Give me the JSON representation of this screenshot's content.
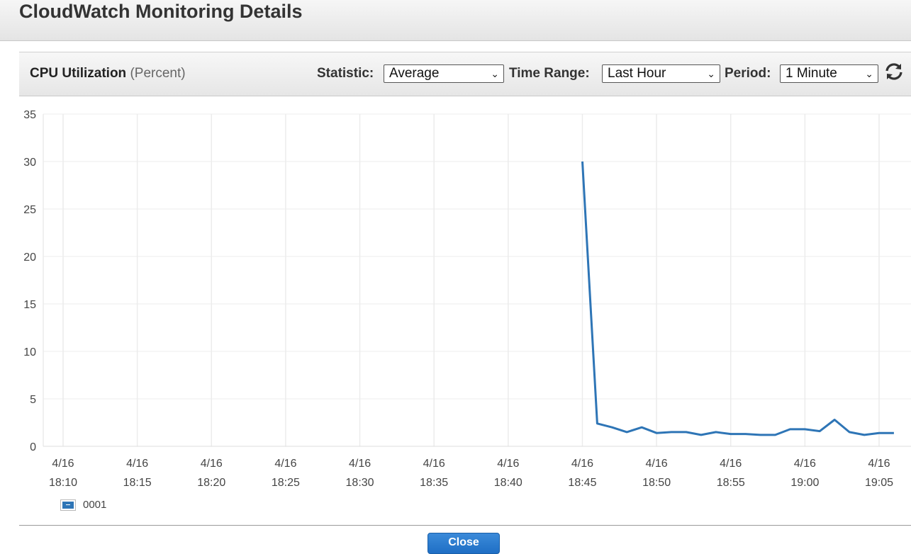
{
  "header": {
    "title": "CloudWatch Monitoring Details"
  },
  "toolbar": {
    "metric_name": "CPU Utilization",
    "metric_unit": "(Percent)",
    "statistic_label": "Statistic:",
    "statistic_value": "Average",
    "time_range_label": "Time Range:",
    "time_range_value": "Last Hour",
    "period_label": "Period:",
    "period_value": "1 Minute",
    "refresh_icon": "refresh-icon"
  },
  "colors": {
    "series": "#2e75b6",
    "grid": "#ececec",
    "axis_text": "#444444"
  },
  "chart_data": {
    "type": "line",
    "title": "",
    "xlabel": "",
    "ylabel": "",
    "ylim": [
      0,
      35
    ],
    "y_ticks": [
      0,
      5,
      10,
      15,
      20,
      25,
      30,
      35
    ],
    "x_range": [
      "18:08",
      "19:06"
    ],
    "x_ticks": [
      {
        "date": "4/16",
        "time": "18:10"
      },
      {
        "date": "4/16",
        "time": "18:15"
      },
      {
        "date": "4/16",
        "time": "18:20"
      },
      {
        "date": "4/16",
        "time": "18:25"
      },
      {
        "date": "4/16",
        "time": "18:30"
      },
      {
        "date": "4/16",
        "time": "18:35"
      },
      {
        "date": "4/16",
        "time": "18:40"
      },
      {
        "date": "4/16",
        "time": "18:45"
      },
      {
        "date": "4/16",
        "time": "18:50"
      },
      {
        "date": "4/16",
        "time": "18:55"
      },
      {
        "date": "4/16",
        "time": "19:00"
      },
      {
        "date": "4/16",
        "time": "19:05"
      }
    ],
    "grid": true,
    "legend_position": "bottom-left",
    "series": [
      {
        "name": "0001",
        "x": [
          "18:45",
          "18:46",
          "18:47",
          "18:48",
          "18:49",
          "18:50",
          "18:51",
          "18:52",
          "18:53",
          "18:54",
          "18:55",
          "18:56",
          "18:57",
          "18:58",
          "18:59",
          "19:00",
          "19:01",
          "19:02",
          "19:03",
          "19:04",
          "19:05",
          "19:06"
        ],
        "y": [
          30.0,
          2.4,
          2.0,
          1.5,
          2.0,
          1.4,
          1.5,
          1.5,
          1.2,
          1.5,
          1.3,
          1.3,
          1.2,
          1.2,
          1.8,
          1.8,
          1.6,
          2.8,
          1.5,
          1.2,
          1.4,
          1.4
        ]
      }
    ]
  },
  "legend": {
    "label": "0001"
  },
  "footer": {
    "close_label": "Close"
  }
}
